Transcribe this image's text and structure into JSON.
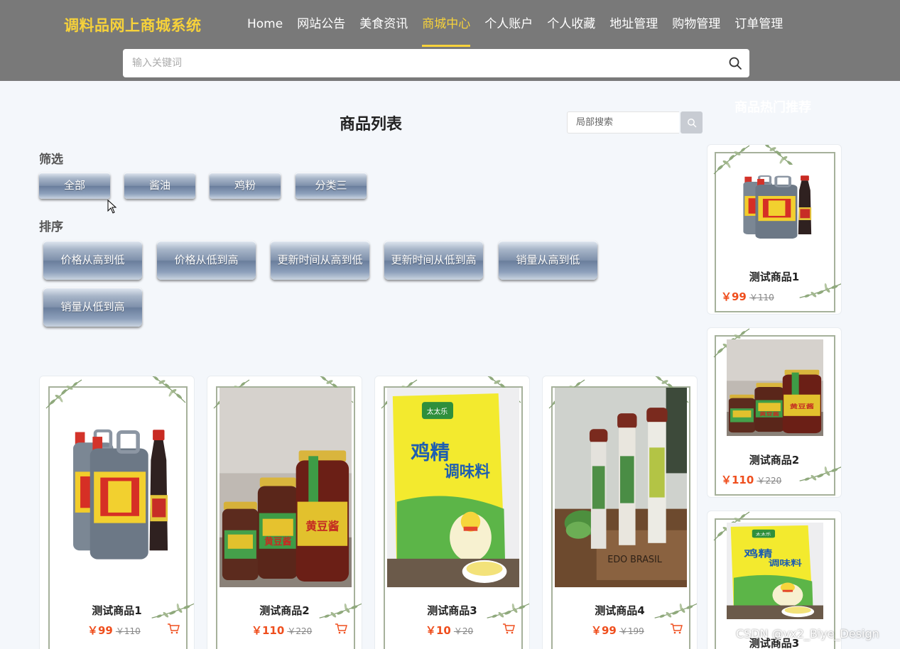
{
  "header": {
    "brand": "调料品网上商城系统",
    "nav": [
      "Home",
      "网站公告",
      "美食资讯",
      "商城中心",
      "个人账户",
      "个人收藏",
      "地址管理",
      "购物管理",
      "订单管理"
    ],
    "active_nav": "商城中心",
    "search_placeholder": "输入关键词"
  },
  "main": {
    "title": "商品列表",
    "local_search_placeholder": "局部搜索",
    "filter_label": "筛选",
    "filters": [
      "全部",
      "酱油",
      "鸡粉",
      "分类三"
    ],
    "sort_label": "排序",
    "sorts": [
      "价格从高到低",
      "价格从低到高",
      "更新时间从高到低",
      "更新时间从低到高",
      "销量从高到低",
      "销量从低到高"
    ],
    "products": [
      {
        "name": "测试商品1",
        "price": "￥99",
        "old_price": "￥110",
        "image": "soy-sauce-bottles"
      },
      {
        "name": "测试商品2",
        "price": "￥110",
        "old_price": "￥220",
        "image": "bean-paste-jars"
      },
      {
        "name": "测试商品3",
        "price": "￥10",
        "old_price": "￥20",
        "image": "chicken-essence-bag"
      },
      {
        "name": "测试商品4",
        "price": "￥99",
        "old_price": "￥199",
        "image": "spice-tubes"
      }
    ]
  },
  "sidebar": {
    "title": "商品热门推荐",
    "items": [
      {
        "name": "测试商品1",
        "price": "￥99",
        "old_price": "￥110",
        "image": "soy-sauce-bottles"
      },
      {
        "name": "测试商品2",
        "price": "￥110",
        "old_price": "￥220",
        "image": "bean-paste-jars"
      },
      {
        "name": "测试商品3",
        "image": "chicken-essence-bag"
      }
    ]
  },
  "watermark": "CSDN @vx2_Biye_Design",
  "colors": {
    "header_bg": "#797979",
    "brand": "#f7d23a",
    "price": "#ef4e1d",
    "page_bg": "#f4f7fb"
  }
}
